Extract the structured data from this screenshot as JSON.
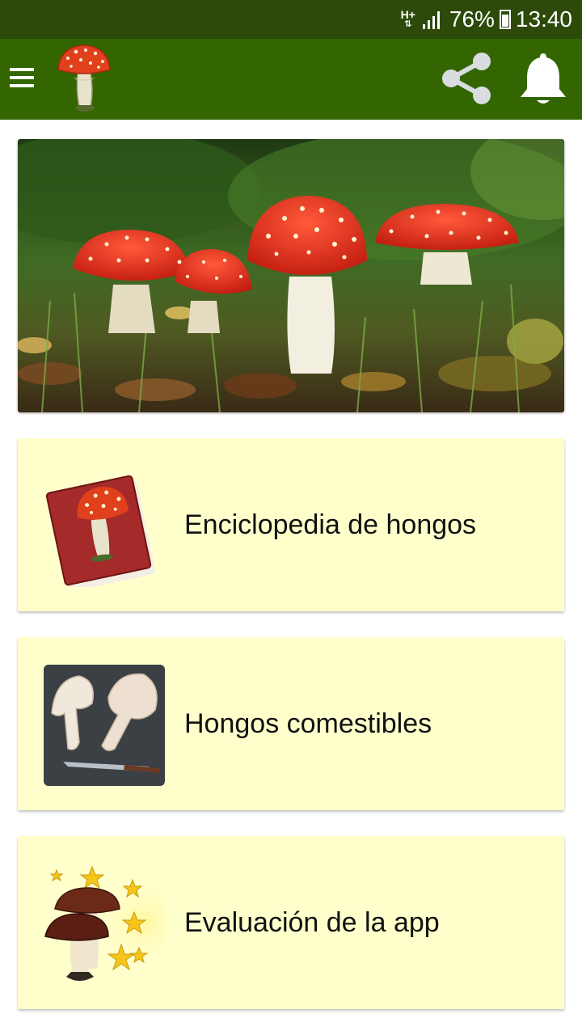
{
  "status_bar": {
    "network": "H+",
    "battery": "76%",
    "time": "13:40",
    "icons": [
      "network-type-icon",
      "signal-icon",
      "battery-charging-icon"
    ]
  },
  "app_bar": {
    "menu_icon": "menu-icon",
    "logo_icon": "mushroom-logo-icon",
    "share_icon": "share-icon",
    "notification_icon": "bell-icon",
    "background": "#336600"
  },
  "hero": {
    "image": "fly-agaric-mushrooms-photo"
  },
  "menu": [
    {
      "label": "Enciclopedia de hongos",
      "icon": "mushroom-book-icon"
    },
    {
      "label": "Hongos comestibles",
      "icon": "edible-mushrooms-photo-icon"
    },
    {
      "label": "Evaluación de la app",
      "icon": "mushrooms-stars-rating-icon"
    }
  ],
  "colors": {
    "status_bar": "#2d4a0a",
    "card_background": "#ffffcc"
  }
}
